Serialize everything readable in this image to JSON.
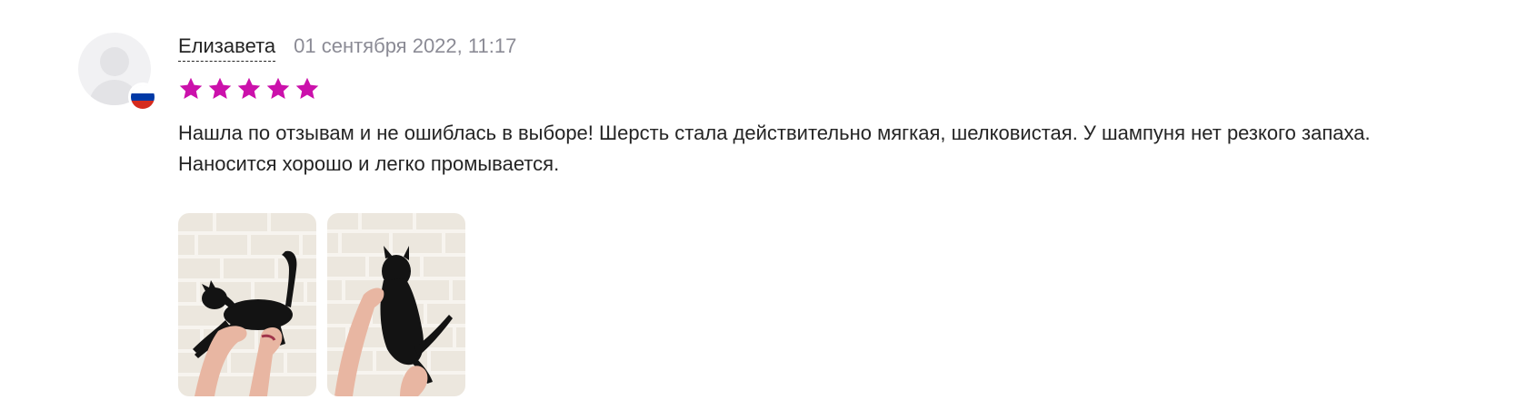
{
  "review": {
    "author": "Елизавета",
    "date": "01 сентября 2022, 11:17",
    "rating": 5,
    "rating_max": 5,
    "text": "Нашла по отзывам и не ошиблась в выборе! Шерсть стала действительно мягкая, шелковистая. У шампуня нет резкого запаха. Наносится хорошо и легко промывается.",
    "country_flag": "russia-flag-icon",
    "photos": [
      {
        "description": "photo-1",
        "icon": "cat-photo"
      },
      {
        "description": "photo-2",
        "icon": "cat-photo"
      }
    ]
  },
  "colors": {
    "star": "#cb11ab",
    "text": "#242424",
    "muted": "#8b8b95",
    "avatar_bg": "#f1f1f3",
    "flag_white": "#ffffff",
    "flag_blue": "#0039a6",
    "flag_red": "#d52b1e"
  }
}
